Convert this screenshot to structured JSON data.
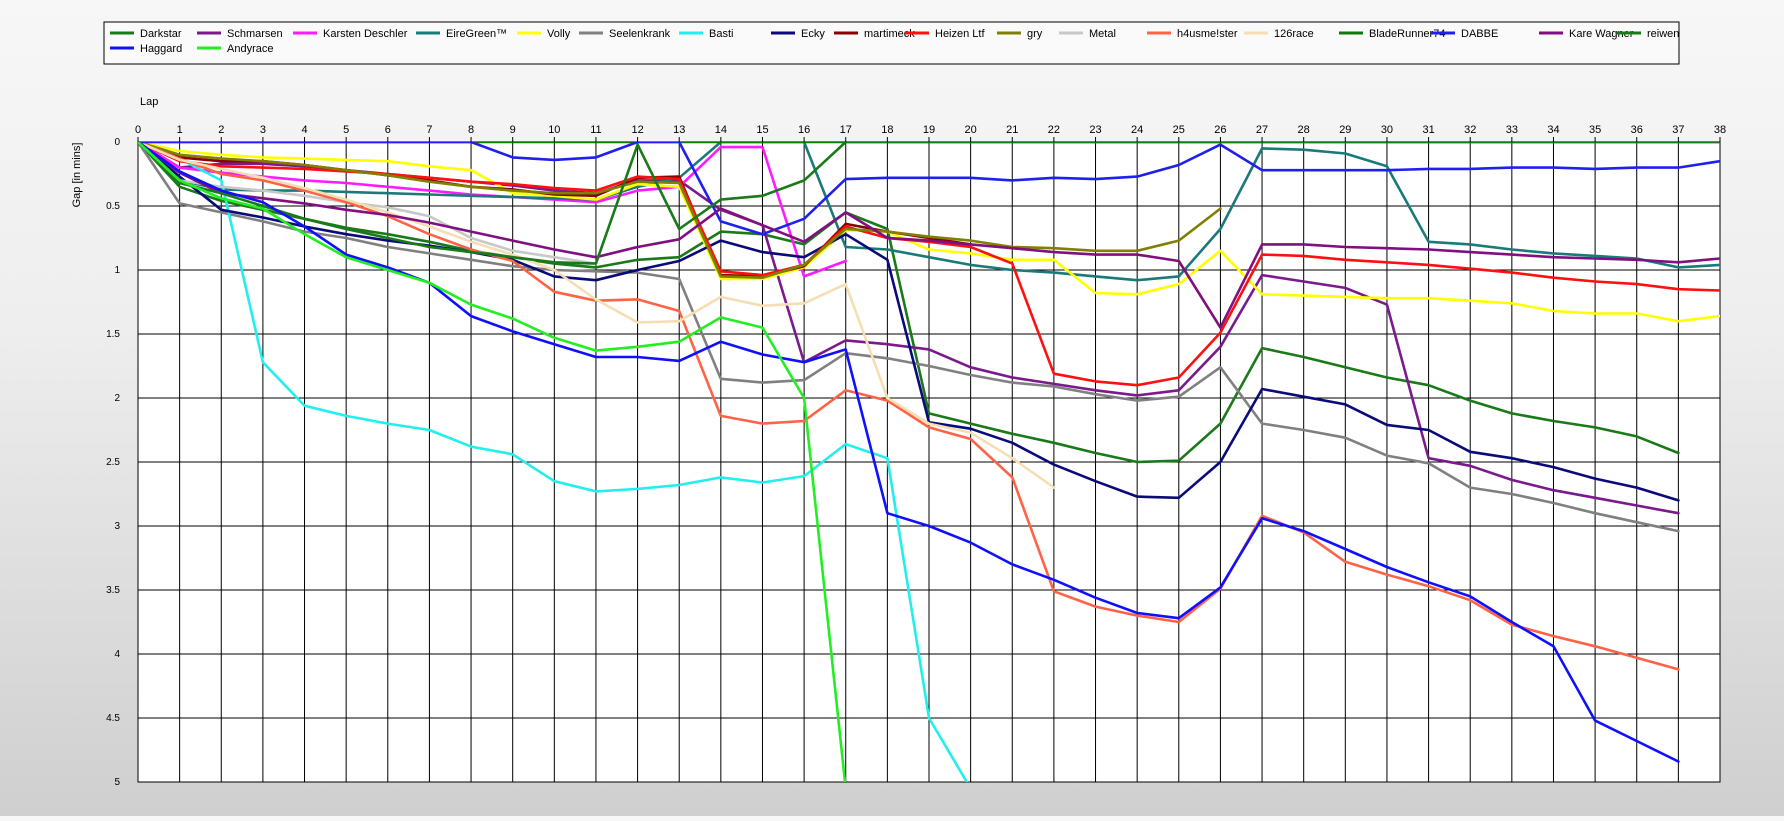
{
  "chart_data": {
    "type": "line",
    "title": "",
    "xlabel": "Lap",
    "ylabel": "Gap [in mins]",
    "x_ticks": [
      "0",
      "1",
      "2",
      "3",
      "4",
      "5",
      "6",
      "7",
      "8",
      "9",
      "10",
      "11",
      "12",
      "13",
      "14",
      "15",
      "16",
      "17",
      "18",
      "19",
      "20",
      "21",
      "22",
      "23",
      "24",
      "25",
      "26",
      "27",
      "28",
      "29",
      "30",
      "31",
      "32",
      "33",
      "34",
      "35",
      "36",
      "37",
      "38"
    ],
    "y_ticks": [
      "0",
      "0.5",
      "1",
      "1.5",
      "2",
      "2.5",
      "3",
      "3.5",
      "4",
      "4.5",
      "5"
    ],
    "xlim": [
      0,
      38
    ],
    "ylim": [
      0,
      5
    ],
    "y_inverted": true,
    "grid": true,
    "legend_position": "top",
    "series": [
      {
        "name": "Darkstar",
        "color": "#1a7a1a",
        "values": [
          0,
          0.35,
          0.46,
          0.53,
          0.6,
          0.67,
          0.72,
          0.78,
          0.85,
          0.9,
          0.95,
          0.98,
          0.92,
          0.9,
          0.7,
          0.72,
          0.8,
          0.55,
          0.68,
          2.12,
          2.2,
          2.28,
          2.35,
          2.43,
          2.5,
          2.49,
          2.2,
          1.61,
          1.68,
          1.76,
          1.84,
          1.9,
          2.02,
          2.12,
          2.18,
          2.23,
          2.3,
          2.43,
          null
        ]
      },
      {
        "name": "Schmarsen",
        "color": "#7b1a8c",
        "values": [
          0,
          0.2,
          0.17,
          0.17,
          0.19,
          0.22,
          0.25,
          0.28,
          0.31,
          0.34,
          0.38,
          0.4,
          0.3,
          0.3,
          0.53,
          0.65,
          1.72,
          1.55,
          1.58,
          1.62,
          1.76,
          1.84,
          1.89,
          1.94,
          1.98,
          1.94,
          1.6,
          1.04,
          1.09,
          1.14,
          1.27,
          2.47,
          2.53,
          2.64,
          2.72,
          2.78,
          2.84,
          2.9,
          null
        ]
      },
      {
        "name": "Karsten Deschler",
        "color": "#ff1aff",
        "values": [
          0,
          0.2,
          0.24,
          0.27,
          0.3,
          0.32,
          0.35,
          0.38,
          0.41,
          0.43,
          0.45,
          0.47,
          0.38,
          0.35,
          0.04,
          0.04,
          1.05,
          0.93,
          null,
          null,
          null,
          null,
          null,
          null,
          null,
          null,
          null,
          null,
          null,
          null,
          null,
          null,
          null,
          null,
          null,
          null,
          null,
          null,
          null
        ]
      },
      {
        "name": "EireGreen™",
        "color": "#1a7a7a",
        "values": [
          0,
          0.3,
          0.37,
          0.38,
          0.38,
          0.39,
          0.4,
          0.41,
          0.42,
          0.43,
          0.44,
          0.45,
          0.35,
          0.28,
          0,
          0,
          0,
          0.82,
          0.84,
          0.9,
          0.96,
          1.0,
          1.02,
          1.05,
          1.08,
          1.05,
          0.68,
          0.05,
          0.06,
          0.09,
          0.19,
          0.78,
          0.8,
          0.84,
          0.87,
          0.89,
          0.91,
          0.98,
          0.96
        ]
      },
      {
        "name": "Volly",
        "color": "#ffff00",
        "values": [
          0,
          0.07,
          0.1,
          0.12,
          0.13,
          0.14,
          0.15,
          0.19,
          0.22,
          0.4,
          0.42,
          0.45,
          0.33,
          0.35,
          1.07,
          1.07,
          0.98,
          0.69,
          0.7,
          0.84,
          0.87,
          0.92,
          0.92,
          1.18,
          1.19,
          1.11,
          0.85,
          1.19,
          1.2,
          1.21,
          1.22,
          1.22,
          1.24,
          1.26,
          1.32,
          1.34,
          1.34,
          1.4,
          1.36
        ]
      },
      {
        "name": "Seelenkrank",
        "color": "#808080",
        "values": [
          0,
          0.48,
          0.55,
          0.62,
          0.7,
          0.75,
          0.82,
          0.87,
          0.92,
          0.97,
          1.0,
          1.01,
          1.02,
          1.07,
          1.85,
          1.88,
          1.86,
          1.65,
          1.69,
          1.75,
          1.82,
          1.88,
          1.91,
          1.97,
          2.02,
          1.99,
          1.76,
          2.2,
          2.25,
          2.31,
          2.45,
          2.51,
          2.7,
          2.75,
          2.82,
          2.9,
          2.97,
          3.04,
          null
        ]
      },
      {
        "name": "Basti",
        "color": "#22eeee",
        "values": [
          0,
          0.13,
          0.3,
          1.72,
          2.06,
          2.14,
          2.2,
          2.25,
          2.38,
          2.44,
          2.65,
          2.73,
          2.71,
          2.68,
          2.62,
          2.66,
          2.61,
          2.36,
          2.47,
          4.5,
          5.05,
          null,
          null,
          null,
          null,
          null,
          null,
          null,
          null,
          null,
          null,
          null,
          null,
          null,
          null,
          null,
          null,
          null,
          null
        ]
      },
      {
        "name": "Ecky",
        "color": "#0a0a7a",
        "values": [
          0,
          0.27,
          0.53,
          0.59,
          0.66,
          0.72,
          0.77,
          0.81,
          0.86,
          0.92,
          1.05,
          1.08,
          1.0,
          0.93,
          0.77,
          0.86,
          0.9,
          0.72,
          0.92,
          2.19,
          2.24,
          2.35,
          2.52,
          2.65,
          2.77,
          2.78,
          2.5,
          1.93,
          1.99,
          2.05,
          2.21,
          2.25,
          2.42,
          2.47,
          2.54,
          2.63,
          2.7,
          2.8,
          null
        ]
      },
      {
        "name": "martimeck",
        "color": "#8b0000",
        "values": [
          0,
          0.12,
          0.15,
          0.15,
          0.18,
          0.22,
          0.26,
          0.3,
          0.35,
          0.37,
          0.41,
          0.42,
          0.28,
          0.27,
          1.04,
          1.05,
          0.97,
          0.64,
          0.7,
          0.75,
          0.8,
          null,
          null,
          null,
          null,
          null,
          null,
          null,
          null,
          null,
          null,
          null,
          null,
          null,
          null,
          null,
          null,
          null,
          null
        ]
      },
      {
        "name": "Heizen Ltf",
        "color": "#ff1010",
        "values": [
          0,
          0.15,
          0.19,
          0.2,
          0.21,
          0.23,
          0.25,
          0.28,
          0.31,
          0.33,
          0.36,
          0.38,
          0.27,
          0.29,
          1.01,
          1.04,
          0.96,
          0.66,
          0.75,
          0.78,
          0.82,
          0.95,
          1.81,
          1.87,
          1.9,
          1.84,
          1.49,
          0.88,
          0.89,
          0.92,
          0.94,
          0.96,
          0.99,
          1.02,
          1.06,
          1.09,
          1.11,
          1.15,
          1.16
        ]
      },
      {
        "name": "gry",
        "color": "#808000",
        "values": [
          0,
          0.1,
          0.13,
          0.15,
          0.18,
          0.22,
          0.26,
          0.31,
          0.35,
          0.38,
          0.4,
          0.4,
          0.31,
          0.32,
          1.05,
          1.06,
          0.96,
          0.68,
          0.7,
          0.74,
          0.77,
          0.82,
          0.83,
          0.85,
          0.85,
          0.77,
          0.52,
          null,
          null,
          null,
          null,
          null,
          null,
          null,
          null,
          null,
          null,
          null,
          null
        ]
      },
      {
        "name": "Metal",
        "color": "#c8c8c8",
        "values": [
          0,
          0.3,
          0.35,
          0.38,
          0.42,
          0.47,
          0.51,
          0.58,
          0.75,
          0.85,
          0.9,
          0.95,
          null,
          null,
          null,
          null,
          null,
          null,
          null,
          null,
          null,
          null,
          null,
          null,
          null,
          null,
          null,
          null,
          null,
          null,
          null,
          null,
          null,
          null,
          null,
          null,
          null,
          null,
          null
        ]
      },
      {
        "name": "h4usme!ster",
        "color": "#ff6347",
        "values": [
          0,
          0.13,
          0.25,
          0.3,
          0.38,
          0.47,
          0.58,
          0.72,
          0.84,
          0.93,
          1.17,
          1.24,
          1.23,
          1.32,
          2.14,
          2.2,
          2.18,
          1.94,
          2.02,
          2.23,
          2.32,
          2.62,
          3.51,
          3.63,
          3.7,
          3.75,
          3.49,
          2.92,
          3.05,
          3.28,
          3.38,
          3.47,
          3.58,
          3.77,
          3.86,
          3.94,
          4.03,
          4.12,
          null
        ]
      },
      {
        "name": "126race",
        "color": "#f5deb3",
        "values": [
          0,
          0.14,
          0.21,
          0.28,
          0.36,
          0.45,
          0.55,
          0.66,
          0.78,
          0.88,
          1.0,
          1.23,
          1.41,
          1.4,
          1.21,
          1.28,
          1.26,
          1.11,
          2.0,
          2.2,
          2.27,
          2.47,
          2.7,
          null,
          null,
          null,
          null,
          null,
          null,
          null,
          null,
          null,
          null,
          null,
          null,
          null,
          null,
          null,
          null
        ]
      },
      {
        "name": "BladeRunner74",
        "color": "#117711",
        "values": [
          0,
          0,
          0,
          0,
          0,
          0,
          0,
          0,
          0,
          0,
          0,
          0,
          0,
          0,
          0,
          0,
          0,
          0,
          0,
          0,
          0,
          0,
          0,
          0,
          0,
          0,
          0,
          0,
          0,
          0,
          0,
          0,
          0,
          0,
          0,
          0,
          0,
          0,
          0
        ]
      },
      {
        "name": "DABBE",
        "color": "#2020ee",
        "values": [
          0,
          0,
          0,
          0,
          0,
          0,
          0,
          0,
          0,
          0.12,
          0.14,
          0.12,
          0,
          0,
          0.62,
          0.72,
          0.6,
          0.29,
          0.28,
          0.28,
          0.28,
          0.3,
          0.28,
          0.29,
          0.27,
          0.18,
          0.02,
          0.22,
          0.22,
          0.22,
          0.22,
          0.21,
          0.21,
          0.2,
          0.2,
          0.21,
          0.2,
          0.2,
          0.15
        ]
      },
      {
        "name": "Kare Wagner",
        "color": "#801080",
        "values": [
          0,
          0.24,
          0.4,
          0.44,
          0.48,
          0.53,
          0.57,
          0.63,
          0.7,
          0.77,
          0.84,
          0.9,
          0.82,
          0.76,
          0.52,
          0.65,
          0.78,
          0.55,
          0.75,
          0.77,
          0.8,
          0.83,
          0.86,
          0.88,
          0.88,
          0.93,
          1.45,
          0.8,
          0.8,
          0.82,
          0.83,
          0.84,
          0.86,
          0.88,
          0.9,
          0.91,
          0.92,
          0.94,
          0.91
        ]
      },
      {
        "name": "reiwen",
        "color": "#1a7a1a",
        "values": [
          0,
          0.32,
          0.4,
          0.5,
          0.6,
          0.68,
          0.75,
          0.82,
          0.86,
          0.9,
          0.94,
          0.95,
          0.02,
          0.68,
          0.45,
          0.42,
          0.3,
          0,
          0,
          0,
          0,
          0,
          0,
          0,
          0,
          0,
          0,
          0,
          0,
          0,
          0,
          0,
          0,
          0,
          0,
          0,
          0,
          0,
          0
        ]
      },
      {
        "name": "Haggard",
        "color": "#1010ff",
        "values": [
          0,
          0.23,
          0.38,
          0.47,
          0.66,
          0.88,
          0.98,
          1.1,
          1.36,
          1.48,
          1.58,
          1.68,
          1.68,
          1.71,
          1.56,
          1.66,
          1.72,
          1.62,
          2.9,
          3.0,
          3.13,
          3.3,
          3.42,
          3.56,
          3.68,
          3.72,
          3.48,
          2.94,
          3.04,
          3.18,
          3.32,
          3.44,
          3.55,
          3.75,
          3.94,
          4.52,
          4.68,
          4.84,
          null
        ]
      },
      {
        "name": "Andyrace",
        "color": "#22ee22",
        "values": [
          0,
          0.3,
          0.44,
          0.52,
          0.72,
          0.9,
          1.0,
          1.1,
          1.27,
          1.38,
          1.53,
          1.63,
          1.6,
          1.56,
          1.37,
          1.45,
          2.0,
          5.05,
          null,
          null,
          null,
          null,
          null,
          null,
          null,
          null,
          null,
          null,
          null,
          null,
          null,
          null,
          null,
          null,
          null,
          null,
          null,
          null,
          null
        ]
      }
    ]
  }
}
